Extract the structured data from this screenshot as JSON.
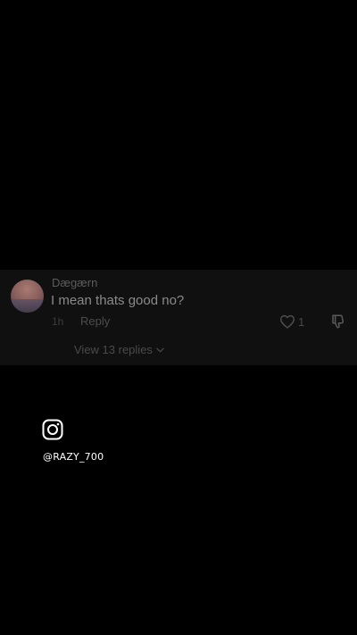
{
  "comment": {
    "username": "Dægærn",
    "text": "I mean thats good no?",
    "timestamp": "1h",
    "reply_label": "Reply",
    "like_count": "1",
    "view_replies_label": "View 13 replies"
  },
  "watermark": {
    "icon": "instagram-icon",
    "handle": "@RAZY_700"
  },
  "colors": {
    "background": "#000000",
    "card": "#101010",
    "text_primary": "#8a8a8a",
    "text_muted": "#4a4a4a",
    "watermark": "#ffffff"
  }
}
